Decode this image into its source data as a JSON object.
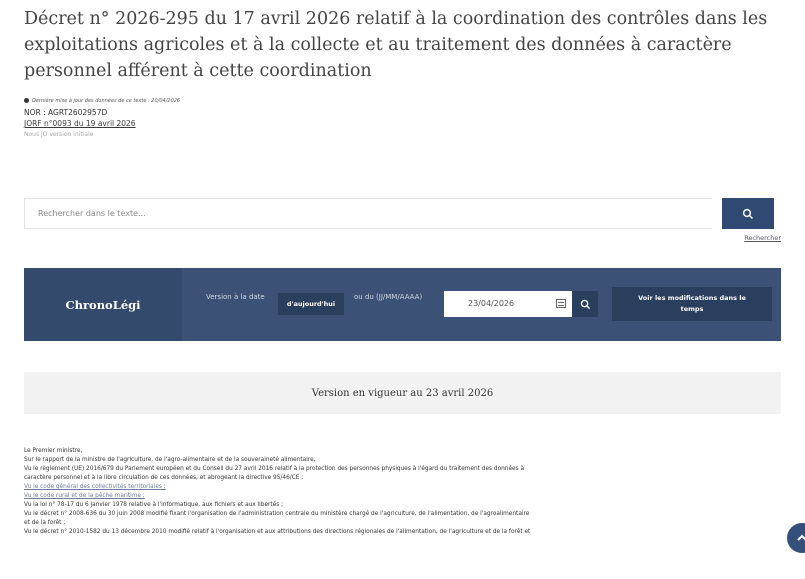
{
  "title": "Décret n° 2026-295 du 17 avril 2026 relatif à la coordination des contrôles dans les exploitations agricoles et à la collecte et au traitement des données à caractère personnel afférent à cette coordination",
  "meta": {
    "last_update": "Dernière mise à jour des données de ce texte : 20/04/2026",
    "nor": "NOR : AGRT2602957D",
    "jorf": "JORF n°0093 du 19 avril 2026",
    "eli": "Nous JO version initiale"
  },
  "search": {
    "placeholder": "Rechercher dans le texte...",
    "advanced_label": "Rechercher"
  },
  "chrono": {
    "title": "ChronoLégi",
    "version_label": "Version à la date",
    "today_button": "d'aujourd'hui",
    "or_label": "ou du (JJ/MM/AAAA)",
    "date_value": "23/04/2026",
    "modifications_button": "Voir les modifications dans le temps"
  },
  "version_banner": "Version en vigueur au 23 avril 2026",
  "body": {
    "lines": [
      "Le Premier ministre,",
      "Sur le rapport de la ministre de l'agriculture, de l'agro-alimentaire et de la souveraineté alimentaire,",
      "Vu le règlement (UE) 2016/679 du Parlement européen et du Conseil du 27 avril 2016 relatif à la protection des personnes physiques à l'égard du traitement des données à",
      "caractère personnel et à la libre circulation de ces données, et abrogeant la directive 95/46/CE ;",
      "Vu le code général des collectivités territoriales ;",
      "Vu le code rural et de la pêche maritime ;",
      "Vu la loi n° 78-17 du 6 janvier 1978 relative à l'informatique, aux fichiers et aux libertés ;",
      "Vu le décret n° 2008-636 du 30 juin 2008 modifié fixant l'organisation de l'administration centrale du ministère chargé de l'agriculture, de l'alimentation, de l'agroalimentaire",
      "et de la forêt ;",
      "Vu le décret n° 2010-1582 du 13 décembre 2010 modifié relatif à l'organisation et aux attributions des directions régionales de l'alimentation, de l'agriculture et de la forêt et"
    ]
  }
}
